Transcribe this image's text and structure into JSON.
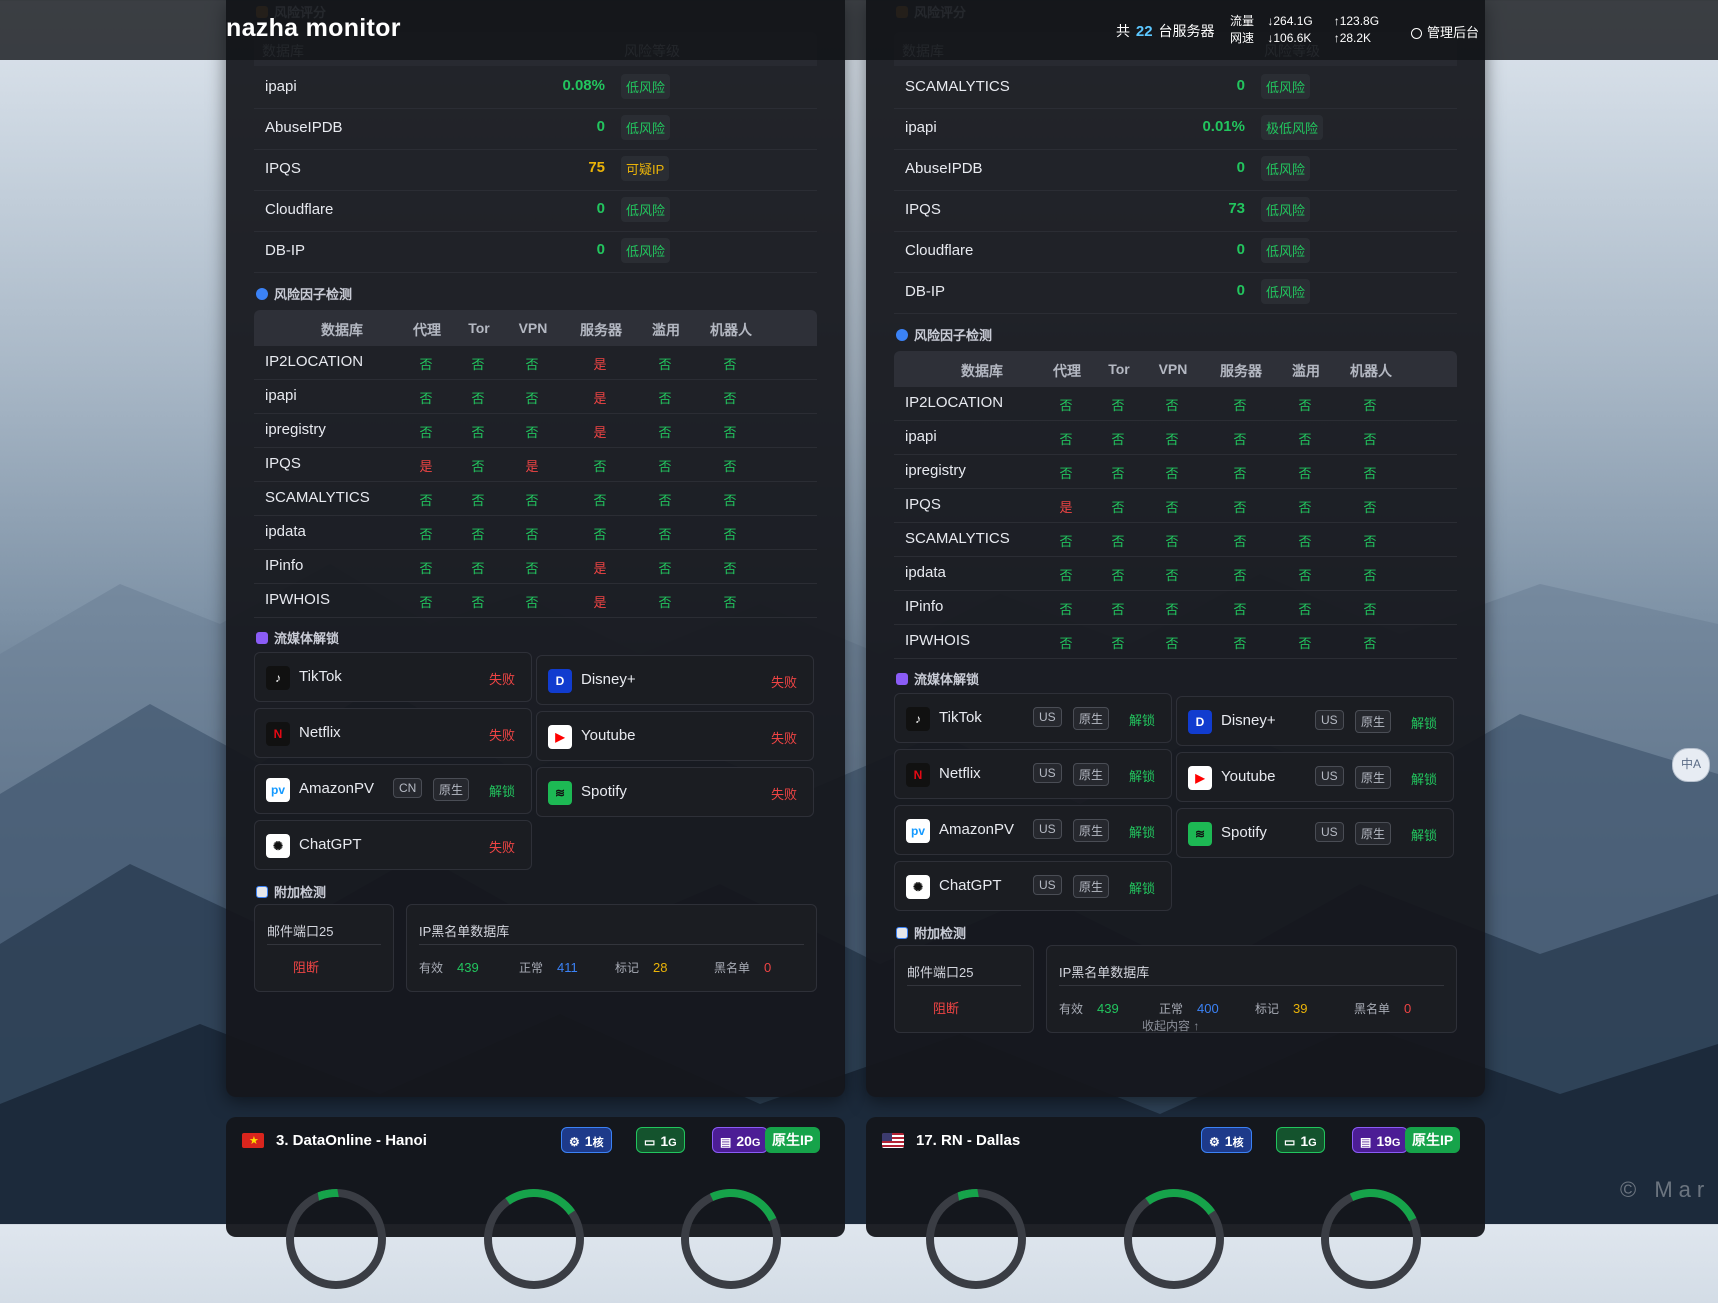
{
  "header": {
    "brand": "nazha monitor",
    "server_prefix": "共",
    "server_count": "22",
    "server_suffix": "台服务器",
    "traffic_label": "流量",
    "traffic_down": "↓264.1G",
    "traffic_up": "↑123.8G",
    "speed_label": "网速",
    "speed_down": "↓106.6K",
    "speed_up": "↑28.2K",
    "admin": "管理后台"
  },
  "left": {
    "risk_title": "风险评分",
    "risk_headers": [
      "数据库",
      "风险等级"
    ],
    "risk_rows": [
      {
        "name": "ipapi",
        "score": "0.08%",
        "level": "低风险",
        "color": "#22c55e"
      },
      {
        "name": "AbuseIPDB",
        "score": "0",
        "level": "低风险",
        "color": "#22c55e"
      },
      {
        "name": "IPQS",
        "score": "75",
        "level": "可疑IP",
        "color": "#eab308"
      },
      {
        "name": "Cloudflare",
        "score": "0",
        "level": "低风险",
        "color": "#22c55e"
      },
      {
        "name": "DB-IP",
        "score": "0",
        "level": "低风险",
        "color": "#22c55e"
      }
    ],
    "factor_title": "风险因子检测",
    "factor_headers": [
      "数据库",
      "代理",
      "Tor",
      "VPN",
      "服务器",
      "滥用",
      "机器人"
    ],
    "factor_rows": [
      {
        "name": "IP2LOCATION",
        "v": [
          "否",
          "否",
          "否",
          "是",
          "否",
          "否"
        ]
      },
      {
        "name": "ipapi",
        "v": [
          "否",
          "否",
          "否",
          "是",
          "否",
          "否"
        ]
      },
      {
        "name": "ipregistry",
        "v": [
          "否",
          "否",
          "否",
          "是",
          "否",
          "否"
        ]
      },
      {
        "name": "IPQS",
        "v": [
          "是",
          "否",
          "是",
          "否",
          "否",
          "否"
        ]
      },
      {
        "name": "SCAMALYTICS",
        "v": [
          "否",
          "否",
          "否",
          "否",
          "否",
          "否"
        ]
      },
      {
        "name": "ipdata",
        "v": [
          "否",
          "否",
          "否",
          "否",
          "否",
          "否"
        ]
      },
      {
        "name": "IPinfo",
        "v": [
          "否",
          "否",
          "否",
          "是",
          "否",
          "否"
        ]
      },
      {
        "name": "IPWHOIS",
        "v": [
          "否",
          "否",
          "否",
          "是",
          "否",
          "否"
        ]
      }
    ],
    "media_title": "流媒体解锁",
    "media": [
      {
        "name": "TikTok",
        "tags": [],
        "status": "失败"
      },
      {
        "name": "Disney+",
        "tags": [],
        "status": "失败"
      },
      {
        "name": "Netflix",
        "tags": [],
        "status": "失败"
      },
      {
        "name": "Youtube",
        "tags": [],
        "status": "失败"
      },
      {
        "name": "AmazonPV",
        "tags": [
          "CN",
          "原生"
        ],
        "status": "解锁"
      },
      {
        "name": "Spotify",
        "tags": [],
        "status": "失败"
      },
      {
        "name": "ChatGPT",
        "tags": [],
        "status": "失败"
      }
    ],
    "extra_title": "附加检测",
    "mail_title": "邮件端口25",
    "mail_status": "阻断",
    "bl_title": "IP黑名单数据库",
    "bl": {
      "valid_label": "有效",
      "valid": "439",
      "normal_label": "正常",
      "normal": "411",
      "marked_label": "标记",
      "marked": "28",
      "black_label": "黑名单",
      "black": "0"
    }
  },
  "right": {
    "risk_title": "风险评分",
    "risk_headers": [
      "数据库",
      "风险等级"
    ],
    "risk_rows": [
      {
        "name": "SCAMALYTICS",
        "score": "0",
        "level": "低风险",
        "color": "#22c55e"
      },
      {
        "name": "ipapi",
        "score": "0.01%",
        "level": "极低风险",
        "color": "#22c55e"
      },
      {
        "name": "AbuseIPDB",
        "score": "0",
        "level": "低风险",
        "color": "#22c55e"
      },
      {
        "name": "IPQS",
        "score": "73",
        "level": "低风险",
        "color": "#22c55e"
      },
      {
        "name": "Cloudflare",
        "score": "0",
        "level": "低风险",
        "color": "#22c55e"
      },
      {
        "name": "DB-IP",
        "score": "0",
        "level": "低风险",
        "color": "#22c55e"
      }
    ],
    "factor_title": "风险因子检测",
    "factor_headers": [
      "数据库",
      "代理",
      "Tor",
      "VPN",
      "服务器",
      "滥用",
      "机器人"
    ],
    "factor_rows": [
      {
        "name": "IP2LOCATION",
        "v": [
          "否",
          "否",
          "否",
          "否",
          "否",
          "否"
        ]
      },
      {
        "name": "ipapi",
        "v": [
          "否",
          "否",
          "否",
          "否",
          "否",
          "否"
        ]
      },
      {
        "name": "ipregistry",
        "v": [
          "否",
          "否",
          "否",
          "否",
          "否",
          "否"
        ]
      },
      {
        "name": "IPQS",
        "v": [
          "是",
          "否",
          "否",
          "否",
          "否",
          "否"
        ]
      },
      {
        "name": "SCAMALYTICS",
        "v": [
          "否",
          "否",
          "否",
          "否",
          "否",
          "否"
        ]
      },
      {
        "name": "ipdata",
        "v": [
          "否",
          "否",
          "否",
          "否",
          "否",
          "否"
        ]
      },
      {
        "name": "IPinfo",
        "v": [
          "否",
          "否",
          "否",
          "否",
          "否",
          "否"
        ]
      },
      {
        "name": "IPWHOIS",
        "v": [
          "否",
          "否",
          "否",
          "否",
          "否",
          "否"
        ]
      }
    ],
    "media_title": "流媒体解锁",
    "media": [
      {
        "name": "TikTok",
        "tags": [
          "US",
          "原生"
        ],
        "status": "解锁"
      },
      {
        "name": "Disney+",
        "tags": [
          "US",
          "原生"
        ],
        "status": "解锁"
      },
      {
        "name": "Netflix",
        "tags": [
          "US",
          "原生"
        ],
        "status": "解锁"
      },
      {
        "name": "Youtube",
        "tags": [
          "US",
          "原生"
        ],
        "status": "解锁"
      },
      {
        "name": "AmazonPV",
        "tags": [
          "US",
          "原生"
        ],
        "status": "解锁"
      },
      {
        "name": "Spotify",
        "tags": [
          "US",
          "原生"
        ],
        "status": "解锁"
      },
      {
        "name": "ChatGPT",
        "tags": [
          "US",
          "原生"
        ],
        "status": "解锁"
      }
    ],
    "extra_title": "附加检测",
    "mail_title": "邮件端口25",
    "mail_status": "阻断",
    "bl_title": "IP黑名单数据库",
    "bl": {
      "valid_label": "有效",
      "valid": "439",
      "normal_label": "正常",
      "normal": "400",
      "marked_label": "标记",
      "marked": "39",
      "black_label": "黑名单",
      "black": "0"
    },
    "collapse": "收起内容 ↑"
  },
  "bottom": [
    {
      "title": "3. DataOnline - Hanoi",
      "flag": "vn",
      "cpu": "1",
      "cpu_unit": "核",
      "ram": "1",
      "ram_unit": "G",
      "disk": "20",
      "disk_unit": "G",
      "native": "原生IP"
    },
    {
      "title": "17. RN - Dallas",
      "flag": "us",
      "cpu": "1",
      "cpu_unit": "核",
      "ram": "1",
      "ram_unit": "G",
      "disk": "19",
      "disk_unit": "G",
      "native": "原生IP"
    }
  ],
  "watermark": "© Mar",
  "translate_button": "中A",
  "colors": {
    "ok": "#22c55e",
    "bad": "#ef4444",
    "warn": "#eab308",
    "info": "#3b82f6"
  }
}
